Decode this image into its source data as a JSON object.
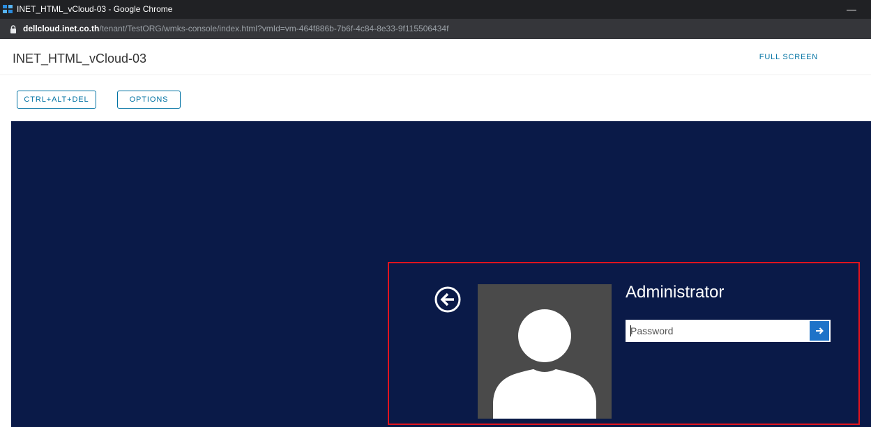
{
  "window": {
    "title": "INET_HTML_vCloud-03 - Google Chrome",
    "minimize_label": "—"
  },
  "address_bar": {
    "host": "dellcloud.inet.co.th",
    "path": "/tenant/TestORG/wmks-console/index.html?vmId=vm-464f886b-7b6f-4c84-8e33-9f115506434f"
  },
  "header": {
    "title": "INET_HTML_vCloud-03",
    "fullscreen_label": "FULL SCREEN"
  },
  "toolbar": {
    "cad_label": "CTRL+ALT+DEL",
    "options_label": "OPTIONS"
  },
  "login": {
    "username": "Administrator",
    "password_placeholder": "Password",
    "password_value": ""
  },
  "colors": {
    "console_bg": "#0a1a48",
    "accent": "#0072a3",
    "highlight": "#e0141e",
    "submit": "#1e73c8"
  },
  "icons": {
    "app": "chrome-app-icon",
    "lock": "lock-icon",
    "back": "back-arrow-circle-icon",
    "avatar": "user-silhouette-icon",
    "submit": "arrow-right-icon"
  }
}
